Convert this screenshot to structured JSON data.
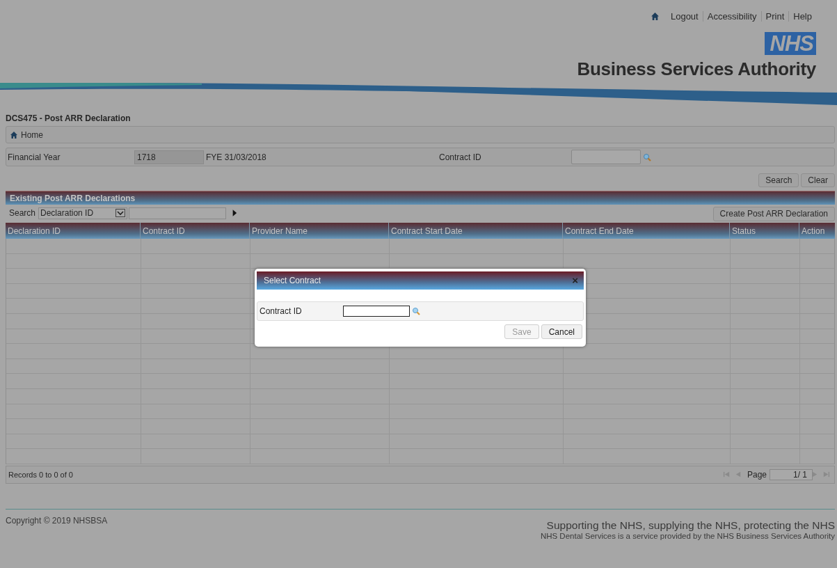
{
  "top_links": [
    "Logout",
    "Accessibility",
    "Print",
    "Help"
  ],
  "logo": {
    "badge": "NHS",
    "name": "Business Services Authority"
  },
  "page_title": "DCS475 - Post ARR Declaration",
  "breadcrumb": "Home",
  "filters": {
    "financial_year_label": "Financial Year",
    "financial_year_value": "1718",
    "fye": "FYE 31/03/2018",
    "contract_id_label": "Contract ID"
  },
  "filter_buttons": [
    "Search",
    "Clear"
  ],
  "grid": {
    "caption": "Existing Post ARR Declarations",
    "search_label": "Search",
    "search_by": "Declaration ID",
    "create_button": "Create Post ARR Declaration",
    "columns": [
      "Declaration ID",
      "Contract ID",
      "Provider Name",
      "Contract Start Date",
      "Contract End Date",
      "Status",
      "Action"
    ],
    "records": "Records 0 to 0 of 0",
    "page_label": "Page",
    "page_count": "1/ 1"
  },
  "dialog": {
    "title": "Select Contract",
    "close": "×",
    "field_label": "Contract ID",
    "buttons": [
      {
        "label": "Save",
        "disabled": true
      },
      {
        "label": "Cancel",
        "disabled": false
      }
    ]
  },
  "footer": {
    "copyright": "Copyright © 2019 NHSBSA",
    "tagline": "Supporting the NHS, supplying the NHS, protecting the NHS",
    "note": "NHS Dental Services is a service provided by the NHS Business Services Authority"
  }
}
